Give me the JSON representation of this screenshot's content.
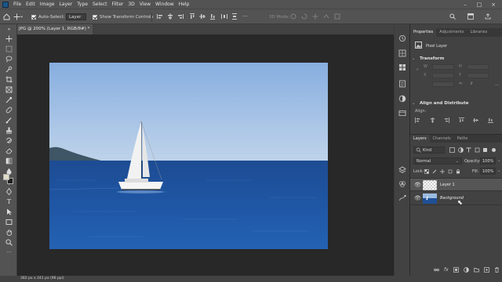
{
  "menu": [
    "File",
    "Edit",
    "Image",
    "Layer",
    "Type",
    "Select",
    "Filter",
    "3D",
    "View",
    "Window",
    "Help"
  ],
  "options": {
    "auto_select_label": "Auto-Select:",
    "auto_select_value": "Layer",
    "show_transform_label": "Show Transform Controls",
    "mode_3d_label": "3D Mode:"
  },
  "document": {
    "tab_title": "JPG @ 200% (Layer 1, RGB/8#) *",
    "close_glyph": "×"
  },
  "status": {
    "text": "382 px x 241 px (96 ppi)"
  },
  "properties": {
    "tabs": [
      "Properties",
      "Adjustments",
      "Libraries"
    ],
    "layer_type": "Pixel Layer",
    "transform_heading": "Transform",
    "align_heading": "Align and Distribute",
    "align_label": "Align:"
  },
  "layers": {
    "tabs": [
      "Layers",
      "Channels",
      "Paths"
    ],
    "filter_value": "Kind",
    "blend_mode": "Normal",
    "opacity_label": "Opacity:",
    "opacity_value": "100%",
    "lock_label": "Lock:",
    "fill_label": "Fill:",
    "fill_value": "100%",
    "items": [
      {
        "name": "Layer 1"
      },
      {
        "name": "Background"
      }
    ]
  },
  "colors": {
    "ui_dark": "#282828",
    "ui_panel": "#535353",
    "selected_row": "#565656",
    "sky": "#9bbbe0",
    "sea": "#1e4f96",
    "foreground_color": "#e2dcc8",
    "background_color": "#1f1f1f"
  }
}
